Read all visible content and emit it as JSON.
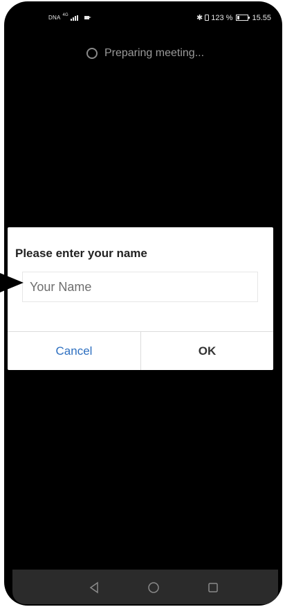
{
  "status_bar": {
    "carrier": "DNA",
    "network": "4G",
    "bluetooth": "✱",
    "battery_percent": "123 %",
    "battery_level": 0.23,
    "time": "15.55"
  },
  "loading": {
    "text": "Preparing meeting..."
  },
  "dialog": {
    "title": "Please enter your name",
    "input_placeholder": "Your Name",
    "input_value": "",
    "cancel_label": "Cancel",
    "ok_label": "OK"
  },
  "navigation": {
    "back_icon": "back-triangle-icon",
    "home_icon": "home-circle-icon",
    "recents_icon": "recents-square-icon"
  },
  "colors": {
    "screen_background": "#000000",
    "dialog_background": "#ffffff",
    "cancel_text": "#2d6fc0",
    "nav_bar": "#2b2b2b"
  }
}
